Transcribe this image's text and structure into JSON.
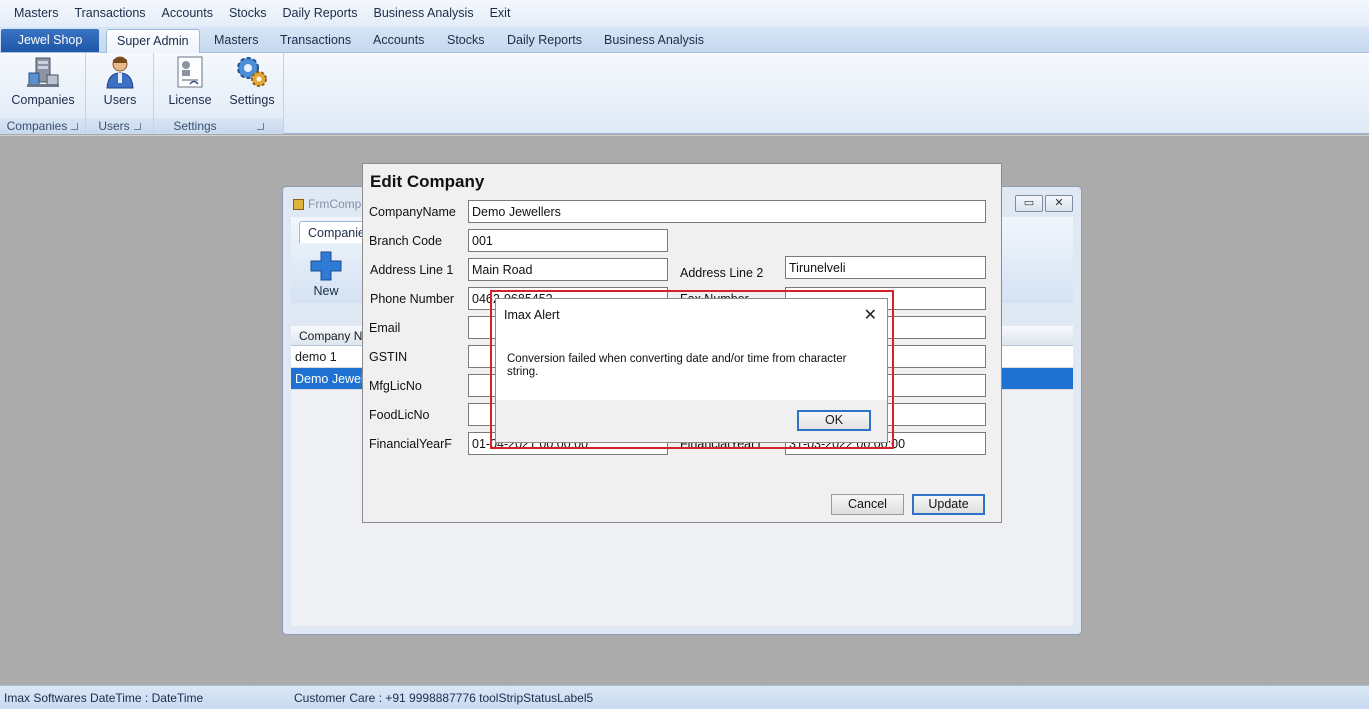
{
  "menu": [
    "Masters",
    "Transactions",
    "Accounts",
    "Stocks",
    "Daily Reports",
    "Business Analysis",
    "Exit"
  ],
  "ribbon_tabs": {
    "app": "Jewel Shop",
    "tabs": [
      "Super Admin",
      "Masters",
      "Transactions",
      "Accounts",
      "Stocks",
      "Daily Reports",
      "Business Analysis"
    ],
    "active": "Super Admin"
  },
  "ribbon_groups": {
    "companies": {
      "button": "Companies",
      "label": "Companies"
    },
    "users": {
      "button": "Users",
      "label": "Users"
    },
    "settings": {
      "buttons": [
        "License",
        "Settings"
      ],
      "label": "Settings"
    }
  },
  "child_window": {
    "title": "FrmComp",
    "tab": "Companie",
    "new_label": "New",
    "grid_header": "Company Nar",
    "rows": [
      "demo 1",
      "Demo Jewell"
    ]
  },
  "edit_company": {
    "title": "Edit Company",
    "fields": {
      "company_name": {
        "label": "CompanyName",
        "value": "Demo Jewellers"
      },
      "branch_code": {
        "label": "Branch Code",
        "value": "001"
      },
      "address1": {
        "label": "Address Line  1",
        "value": "Main Road"
      },
      "address2": {
        "label": "Address Line 2",
        "value": "Tirunelveli"
      },
      "phone": {
        "label": "Phone Number",
        "value": "0462-9685452"
      },
      "fax": {
        "label": "Fax Number",
        "value": ""
      },
      "email": {
        "label": "Email",
        "value": ""
      },
      "gstin": {
        "label": "GSTIN",
        "value": ""
      },
      "mfglic": {
        "label": "MfgLicNo",
        "value": ""
      },
      "foodlic": {
        "label": "FoodLicNo",
        "value": ""
      },
      "fy_from": {
        "label": "FinancialYearF",
        "value": "01-04-2021 00:00:00"
      },
      "fy_to": {
        "label": "FinancialYearT",
        "value": "31-03-2022 00:00:00"
      }
    },
    "cancel": "Cancel",
    "update": "Update"
  },
  "alert": {
    "title": "Imax Alert",
    "message": "Conversion failed when converting date and/or time from character string.",
    "ok": "OK",
    "highlight_color": "#d6202a"
  },
  "status": {
    "left": "Imax Softwares  DateTime  : DateTime",
    "right": "Customer Care : +91 9998887776  toolStripStatusLabel5"
  },
  "colors": {
    "accent": "#1f72d1",
    "app_tab": "#1e55a8"
  }
}
